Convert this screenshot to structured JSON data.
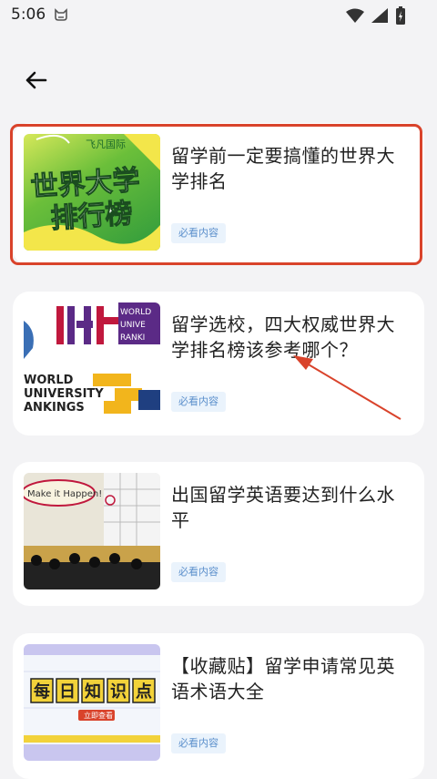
{
  "status_bar": {
    "time": "5:06"
  },
  "articles": [
    {
      "title": "留学前一定要搞懂的世界大学排名",
      "tag": "必看内容",
      "thumb": {
        "logo": "飞凡国际",
        "line1": "世界大学",
        "line2": "排行榜"
      }
    },
    {
      "title": "留学选校，四大权威世界大学排名榜该参考哪个？",
      "tag": "必看内容",
      "thumb": {
        "text1": "THE",
        "text2": "WORLD",
        "text3": "UNIVE",
        "text4": "RANKI",
        "text5": "WORLD",
        "text6": "UNIVERSITY",
        "text7": "ANKINGS"
      }
    },
    {
      "title": "出国留学英语要达到什么水平",
      "tag": "必看内容",
      "thumb": {
        "bubble": "Make it Happen!"
      }
    },
    {
      "title": "【收藏贴】留学申请常见英语术语大全",
      "tag": "必看内容",
      "thumb": {
        "chars": [
          "每",
          "日",
          "知",
          "识",
          "点"
        ],
        "button": "立即查看"
      }
    }
  ],
  "colors": {
    "highlight": "#d9432b",
    "tag_bg": "#eaf3fc",
    "tag_text": "#5b8fcb"
  }
}
